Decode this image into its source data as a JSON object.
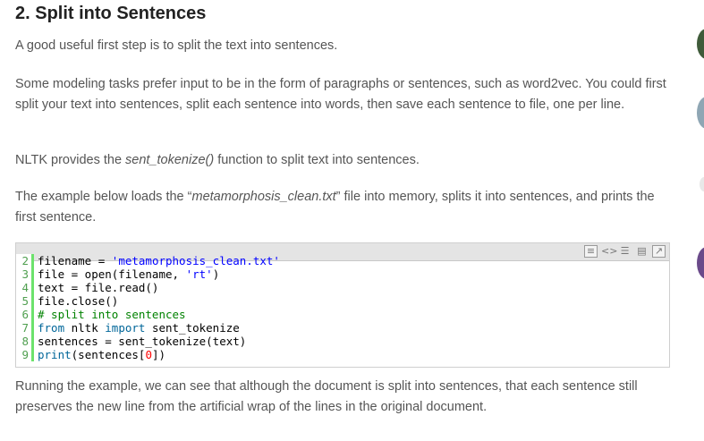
{
  "heading": "2. Split into Sentences",
  "p1": "A good useful first step is to split the text into sentences.",
  "p2": "Some modeling tasks prefer input to be in the form of paragraphs or sentences, such as word2vec. You could first split your text into sentences, split each sentence into words, then save each sentence to file, one per line.",
  "p3_pre": "NLTK provides the ",
  "p3_em": "sent_tokenize()",
  "p3_post": " function to split text into sentences.",
  "p4_pre": "The example below loads the “",
  "p4_em": "metamorphosis_clean.txt",
  "p4_post": "” file into memory, splits it into sentences, and prints the first sentence.",
  "code": {
    "toolbar_icons": [
      "view-source-icon",
      "code-icon",
      "copy-icon",
      "clipboard-icon",
      "popup-icon"
    ],
    "lines": [
      {
        "n": "2",
        "parts": [
          {
            "t": "filename = ",
            "c": "fn"
          },
          {
            "t": "'metamorphosis_clean.txt'",
            "c": "str"
          }
        ]
      },
      {
        "n": "3",
        "parts": [
          {
            "t": "file = open(filename, ",
            "c": "fn"
          },
          {
            "t": "'rt'",
            "c": "str"
          },
          {
            "t": ")",
            "c": "fn"
          }
        ]
      },
      {
        "n": "4",
        "parts": [
          {
            "t": "text = file.read()",
            "c": "fn"
          }
        ]
      },
      {
        "n": "5",
        "parts": [
          {
            "t": "file.close()",
            "c": "fn"
          }
        ]
      },
      {
        "n": "6",
        "parts": [
          {
            "t": "# split into sentences",
            "c": "cm"
          }
        ]
      },
      {
        "n": "7",
        "parts": [
          {
            "t": "from",
            "c": "kw"
          },
          {
            "t": " nltk ",
            "c": "fn"
          },
          {
            "t": "import",
            "c": "kw"
          },
          {
            "t": " sent_tokenize",
            "c": "fn"
          }
        ]
      },
      {
        "n": "8",
        "parts": [
          {
            "t": "sentences = sent_tokenize(text)",
            "c": "fn"
          }
        ]
      },
      {
        "n": "9",
        "parts": [
          {
            "t": "print",
            "c": "kw"
          },
          {
            "t": "(sentences[",
            "c": "fn"
          },
          {
            "t": "0",
            "c": "num"
          },
          {
            "t": "])",
            "c": "fn"
          }
        ]
      }
    ]
  },
  "p5": "Running the example, we can see that although the document is split into sentences, that each sentence still preserves the new line from the artificial wrap of the lines in the original document.",
  "colors": {
    "accent": "#6ce26c",
    "heading": "#222222",
    "text": "#555555"
  }
}
